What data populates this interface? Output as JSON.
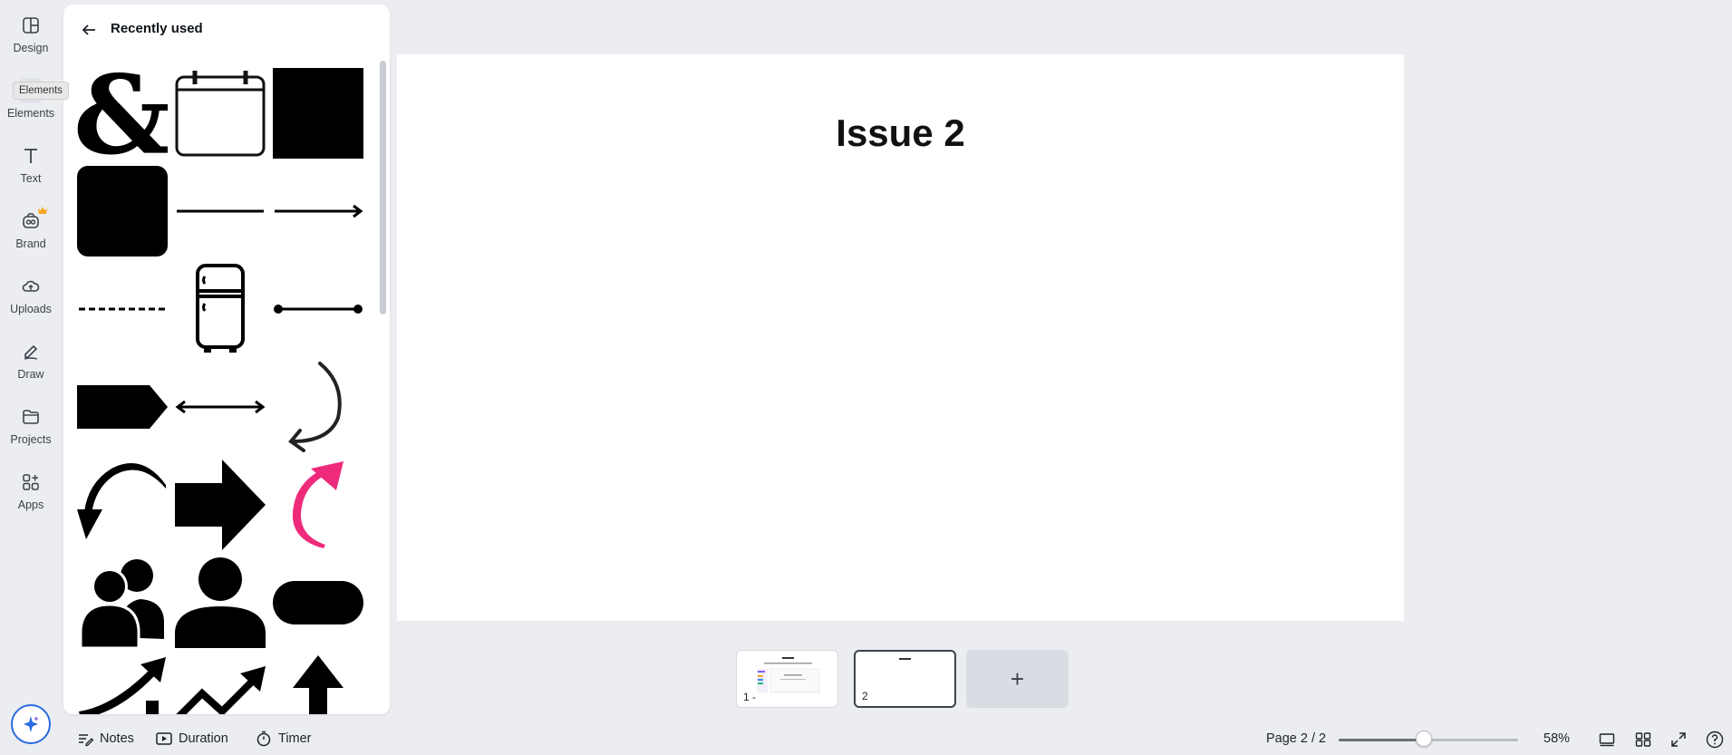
{
  "rail": {
    "items": [
      {
        "label": "Design",
        "icon": "design-icon"
      },
      {
        "label": "Elements",
        "icon": "elements-icon"
      },
      {
        "label": "Text",
        "icon": "text-icon"
      },
      {
        "label": "Brand",
        "icon": "brand-icon"
      },
      {
        "label": "Uploads",
        "icon": "uploads-icon"
      },
      {
        "label": "Draw",
        "icon": "draw-icon"
      },
      {
        "label": "Projects",
        "icon": "projects-icon"
      },
      {
        "label": "Apps",
        "icon": "apps-icon"
      }
    ],
    "tooltip": "Elements",
    "active": "Elements"
  },
  "panel": {
    "title": "Recently used",
    "elements": [
      "ampersand",
      "calendar",
      "black-square",
      "rounded-square",
      "line",
      "arrow-line",
      "dashed-line",
      "fridge",
      "dot-line",
      "tag-shape",
      "double-arrow",
      "curved-arrow-outline",
      "curved-arrow-brush",
      "block-arrow",
      "pink-curved-arrow",
      "people-group",
      "person",
      "pill-shape",
      "growth-chart-arrow",
      "trend-line-arrow",
      "up-arrow"
    ]
  },
  "canvas": {
    "title": "Issue 2"
  },
  "pages": {
    "thumbs": [
      {
        "num": "1 -",
        "title": "Issue 1"
      },
      {
        "num": "2",
        "title": "Issue 2"
      }
    ],
    "add_label": "+"
  },
  "bottom": {
    "notes": "Notes",
    "duration": "Duration",
    "timer": "Timer",
    "page_indicator": "Page 2 / 2",
    "zoom_value": 0.58,
    "zoom": "58%"
  },
  "colors": {
    "accent_pink": "#ee2a7b",
    "magic_blue": "#2b6ae0",
    "brand_crown": "#f5a623"
  }
}
